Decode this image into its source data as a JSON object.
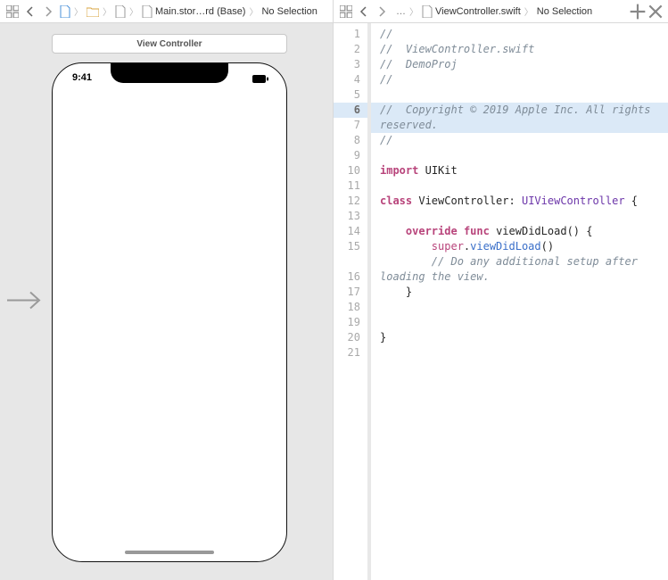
{
  "left": {
    "breadcrumb": {
      "file_trunc": "Main.stor…rd (Base)",
      "selection": "No Selection"
    },
    "scene_title": "View Controller",
    "status_time": "9:41"
  },
  "right": {
    "breadcrumb": {
      "ellipsis": "…",
      "file": "ViewController.swift",
      "selection": "No Selection"
    },
    "code": {
      "lines": [
        {
          "n": 1,
          "type": "cmt",
          "text": "//"
        },
        {
          "n": 2,
          "type": "cmt",
          "text": "//  ViewController.swift"
        },
        {
          "n": 3,
          "type": "cmt",
          "text": "//  DemoProj"
        },
        {
          "n": 4,
          "type": "cmt",
          "text": "//"
        },
        {
          "n": 5,
          "type": "blank",
          "text": ""
        },
        {
          "n": 6,
          "type": "cmt_hl",
          "text": "//  Copyright © 2019 Apple Inc. All rights reserved."
        },
        {
          "n": 7,
          "type": "cmt",
          "text": "//"
        },
        {
          "n": 8,
          "type": "blank",
          "text": ""
        },
        {
          "n": 9,
          "type": "import",
          "kw": "import",
          "mod": "UIKit"
        },
        {
          "n": 10,
          "type": "blank",
          "text": ""
        },
        {
          "n": 11,
          "type": "classdecl",
          "kw": "class",
          "name": "ViewController",
          "colon": ":",
          "super": "UIViewController",
          "brace": "{"
        },
        {
          "n": 12,
          "type": "blank",
          "text": ""
        },
        {
          "n": 13,
          "type": "funcdecl",
          "indent": "    ",
          "kw1": "override",
          "kw2": "func",
          "name": "viewDidLoad",
          "rest": "() {"
        },
        {
          "n": 14,
          "type": "supercall",
          "indent": "        ",
          "kw": "super",
          "dot": ".",
          "fn": "viewDidLoad",
          "rest": "()"
        },
        {
          "n": 15,
          "type": "cmt_wrap",
          "indent": "        ",
          "text": "// Do any additional setup after loading the view."
        },
        {
          "n": 16,
          "type": "plain",
          "text": "    }"
        },
        {
          "n": 17,
          "type": "blank",
          "text": ""
        },
        {
          "n": 18,
          "type": "blank",
          "text": ""
        },
        {
          "n": 19,
          "type": "plain",
          "text": "}"
        },
        {
          "n": 20,
          "type": "blank",
          "text": ""
        },
        {
          "n": 21,
          "type": "blank",
          "text": ""
        }
      ]
    }
  }
}
